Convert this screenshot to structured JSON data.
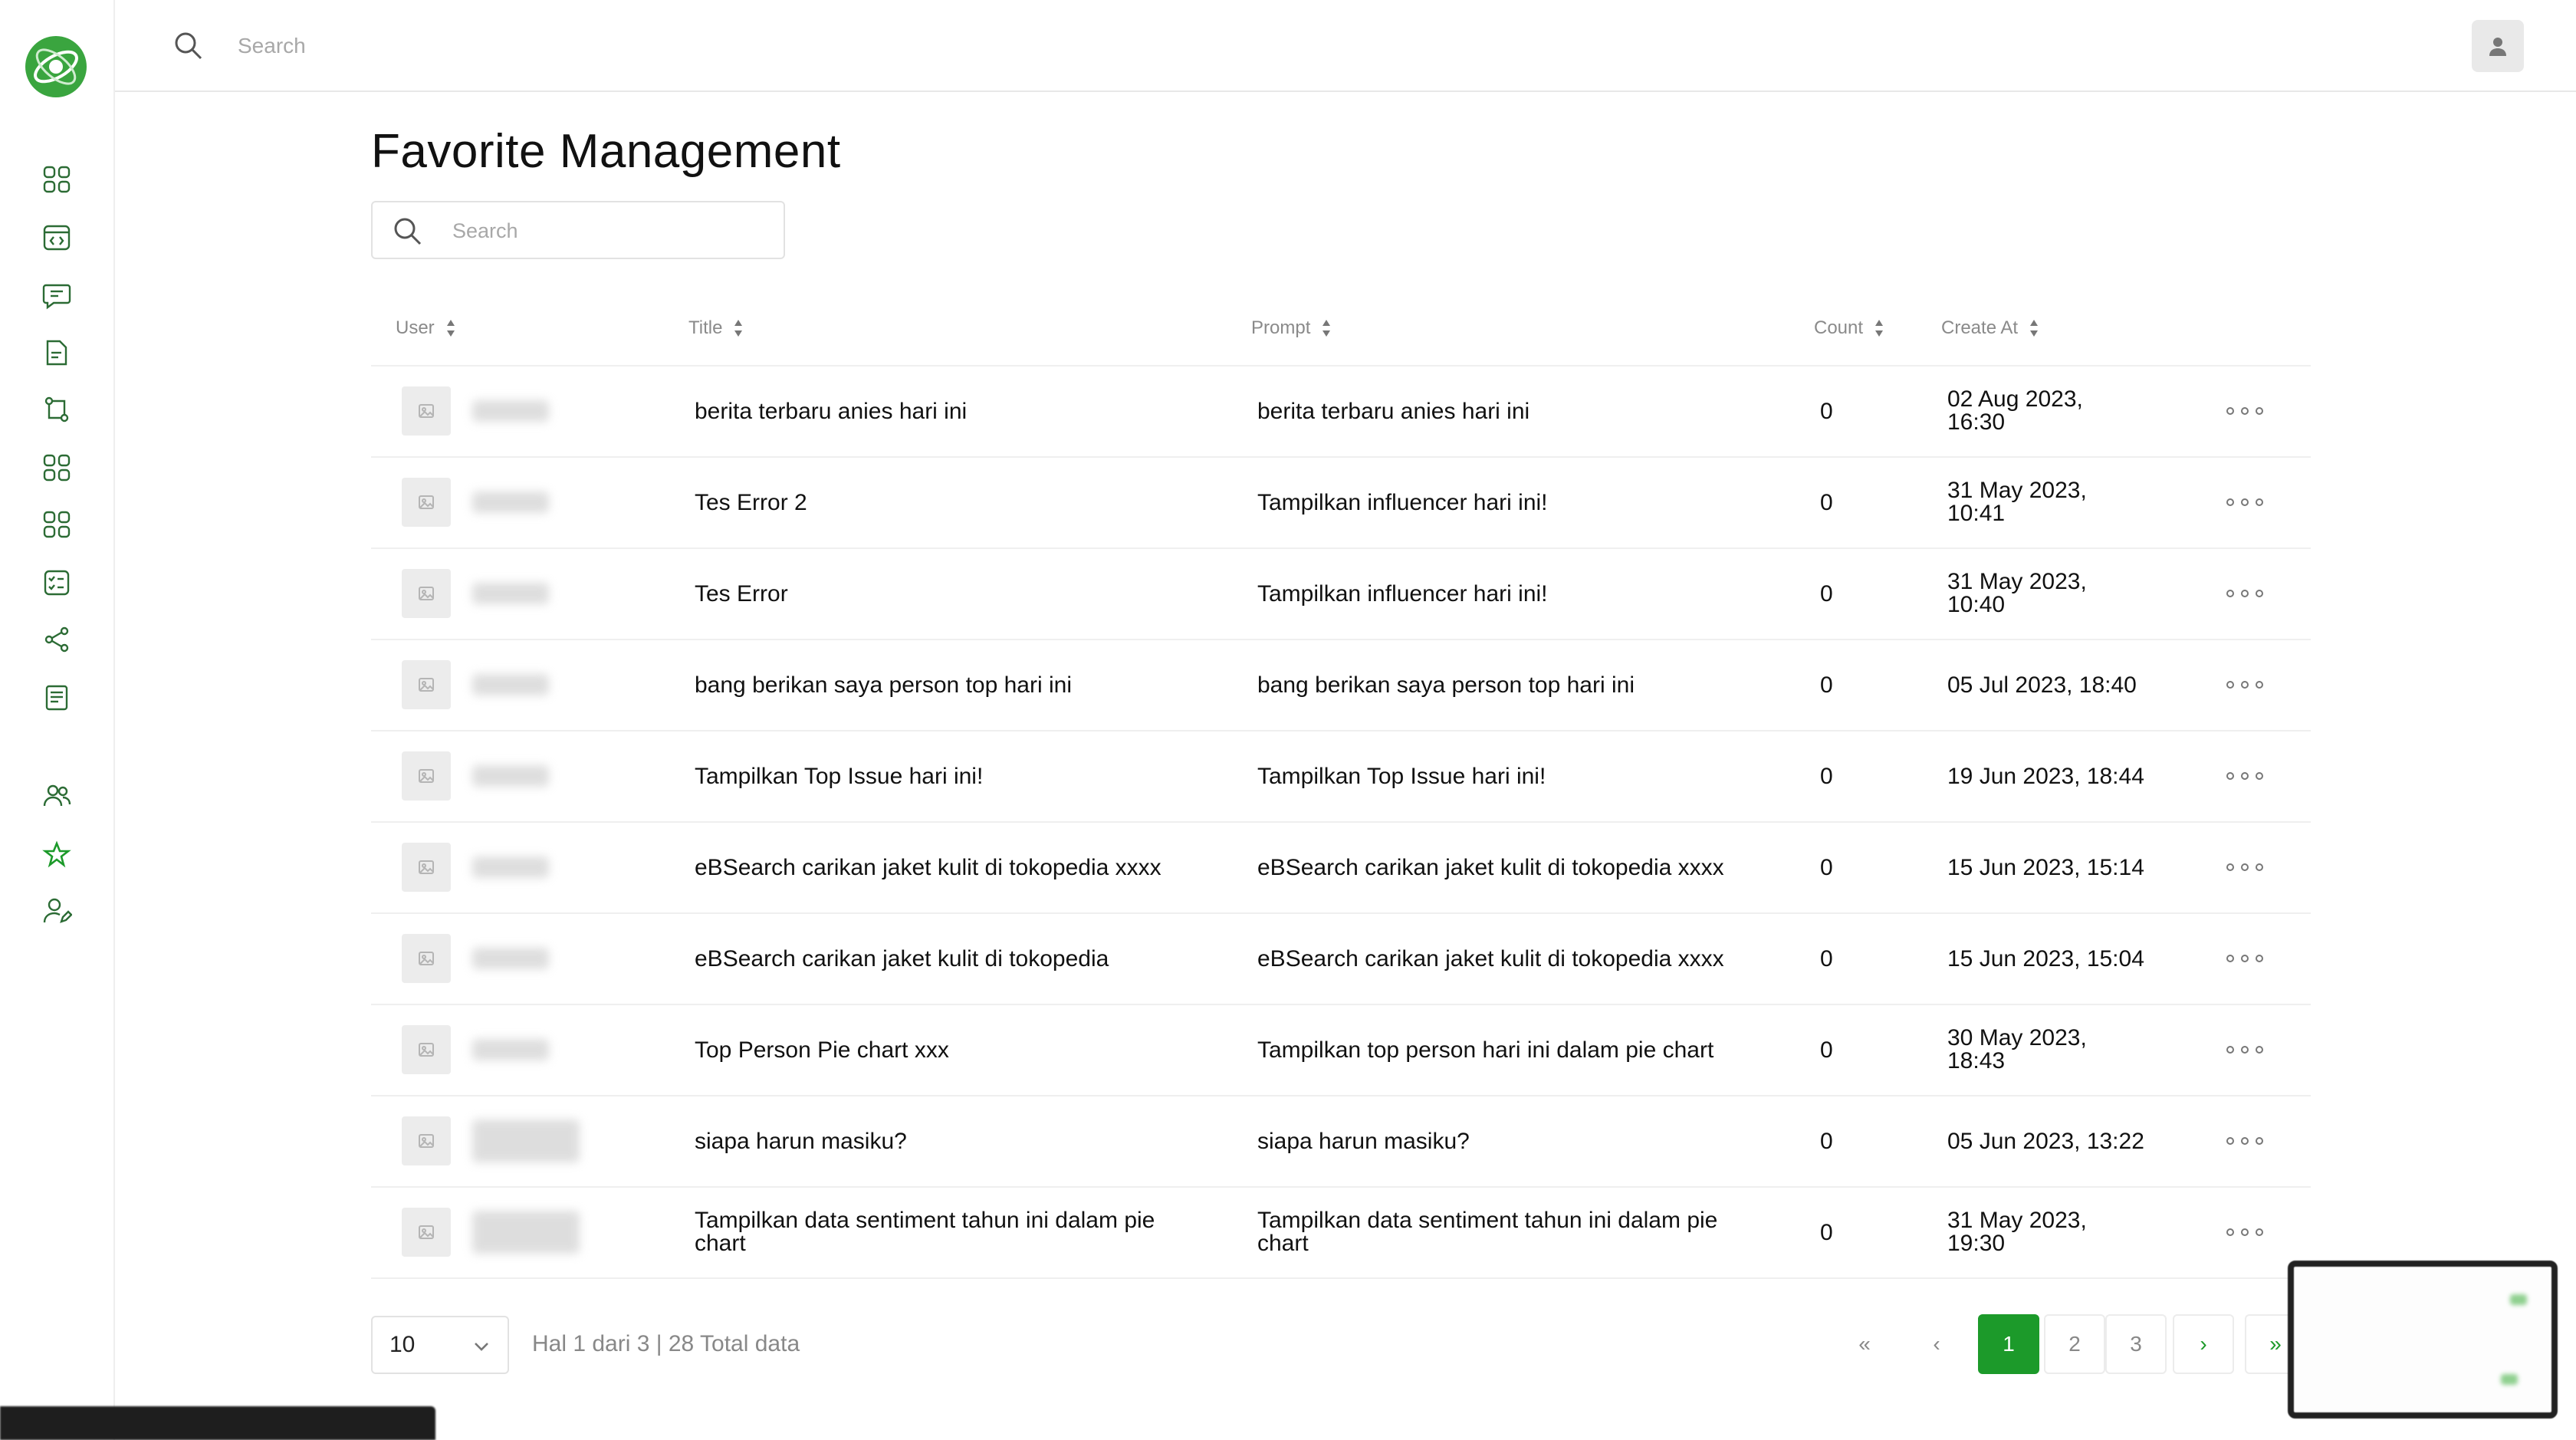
{
  "topbar": {
    "search_placeholder": "Search"
  },
  "sidebar": {
    "logo": "app-logo",
    "items": [
      {
        "icon": "grid-icon"
      },
      {
        "icon": "code-window-icon"
      },
      {
        "icon": "chat-icon"
      },
      {
        "icon": "document-icon"
      },
      {
        "icon": "flow-icon"
      },
      {
        "icon": "grid-icon"
      },
      {
        "icon": "grid-icon"
      },
      {
        "icon": "checklist-icon"
      },
      {
        "icon": "share-icon"
      },
      {
        "icon": "notes-icon"
      },
      {
        "icon": "users-icon"
      },
      {
        "icon": "star-icon",
        "active": true
      },
      {
        "icon": "user-edit-icon"
      }
    ]
  },
  "page": {
    "title": "Favorite Management",
    "search_placeholder": "Search"
  },
  "table": {
    "columns": [
      "User",
      "Title",
      "Prompt",
      "Count",
      "Create At"
    ],
    "rows": [
      {
        "title": "berita terbaru anies hari ini",
        "prompt": "berita terbaru anies hari ini",
        "count": "0",
        "created_line1": "02 Aug 2023,",
        "created_line2": "16:30"
      },
      {
        "title": "Tes Error 2",
        "prompt": "Tampilkan influencer hari ini!",
        "count": "0",
        "created_line1": "31 May 2023,",
        "created_line2": "10:41"
      },
      {
        "title": "Tes Error",
        "prompt": "Tampilkan influencer hari ini!",
        "count": "0",
        "created_line1": "31 May 2023,",
        "created_line2": "10:40"
      },
      {
        "title": "bang berikan saya person top hari ini",
        "prompt": "bang berikan saya person top hari ini",
        "count": "0",
        "created_line1": "05 Jul 2023, 18:40",
        "created_line2": ""
      },
      {
        "title": "Tampilkan Top Issue hari ini!",
        "prompt": "Tampilkan Top Issue hari ini!",
        "count": "0",
        "created_line1": "19 Jun 2023, 18:44",
        "created_line2": ""
      },
      {
        "title": "eBSearch carikan jaket kulit di tokopedia xxxx",
        "prompt": "eBSearch carikan jaket kulit di tokopedia xxxx",
        "count": "0",
        "created_line1": "15 Jun 2023, 15:14",
        "created_line2": ""
      },
      {
        "title": "eBSearch carikan jaket kulit di tokopedia",
        "prompt": "eBSearch carikan jaket kulit di tokopedia xxxx",
        "count": "0",
        "created_line1": "15 Jun 2023, 15:04",
        "created_line2": ""
      },
      {
        "title": "Top Person Pie chart xxx",
        "prompt": "Tampilkan top person hari ini dalam pie chart",
        "count": "0",
        "created_line1": "30 May 2023,",
        "created_line2": "18:43"
      },
      {
        "title": "siapa harun masiku?",
        "prompt": "siapa harun masiku?",
        "count": "0",
        "created_line1": "05 Jun 2023, 13:22",
        "created_line2": ""
      },
      {
        "title_line1": "Tampilkan data sentiment tahun ini dalam pie",
        "title_line2": "chart",
        "prompt_line1": "Tampilkan data sentiment tahun ini dalam pie",
        "prompt_line2": "chart",
        "count": "0",
        "created_line1": "31 May 2023,",
        "created_line2": "19:30"
      }
    ]
  },
  "footer": {
    "page_size": "10",
    "info": "Hal 1 dari 3 | 28 Total data",
    "pages": [
      "1",
      "2",
      "3"
    ],
    "first": "«",
    "prev": "‹",
    "next": "›",
    "last": "»"
  },
  "colors": {
    "accent": "#1c9a2a",
    "border": "#efefef",
    "muted": "#8a8a8a"
  }
}
